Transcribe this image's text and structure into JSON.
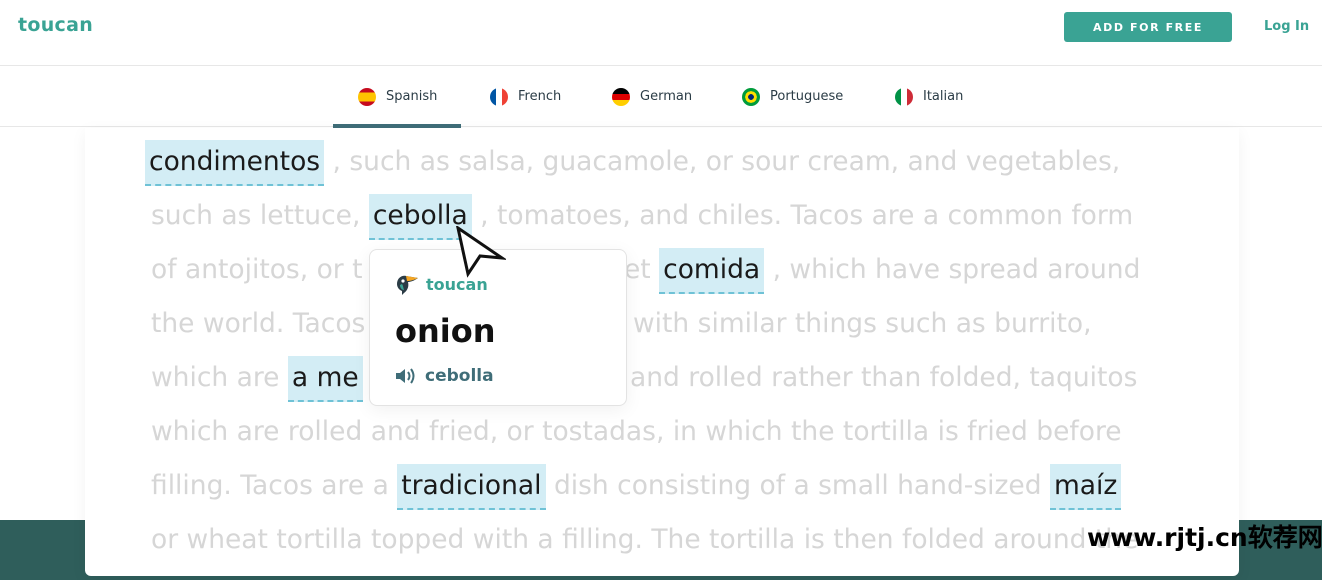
{
  "header": {
    "logo": "toucan",
    "add_button": "ADD FOR FREE",
    "login": "Log In"
  },
  "tabs": [
    {
      "label": "Spanish",
      "flag": "spain-flag-icon",
      "active": true
    },
    {
      "label": "French",
      "flag": "france-flag-icon",
      "active": false
    },
    {
      "label": "German",
      "flag": "germany-flag-icon",
      "active": false
    },
    {
      "label": "Portuguese",
      "flag": "brazil-flag-icon",
      "active": false
    },
    {
      "label": "Italian",
      "flag": "italy-flag-icon",
      "active": false
    }
  ],
  "text": {
    "l1": {
      "hl1": "condimentos",
      "rest": " , such as salsa, guacamole, or sour cream, and vegetables,"
    },
    "l2": {
      "pre": "such as lettuce, ",
      "hl1": "cebolla",
      "rest": " , tomatoes, and chiles. Tacos are a common form"
    },
    "l3": {
      "pre": "of antojitos, or t",
      "mid": "et ",
      "hl1": "comida",
      "rest": " , which have spread around"
    },
    "l4": {
      "pre": "the world. Tacos",
      "rest": "with similar things such as burrito,"
    },
    "l5": {
      "pre": "which are ",
      "hl1": "a me",
      "rest": "and rolled rather than folded, taquitos"
    },
    "l6": {
      "rest": "which are rolled and fried, or tostadas, in which the tortilla is fried before"
    },
    "l7": {
      "pre": "filling.  Tacos are a ",
      "hl1": "tradicional",
      "mid": " dish consisting of a small hand-sized ",
      "hl2": "maíz"
    },
    "l8": {
      "rest": "or wheat tortilla topped with a filling. The tortilla is then folded around the"
    }
  },
  "popup": {
    "brand": "toucan",
    "translation": "onion",
    "source_word": "cebolla"
  },
  "watermark": "www.rjtj.cn软荐网",
  "colors": {
    "accent": "#3aa394",
    "highlight": "#d3edf5",
    "band": "#2f5e5b"
  }
}
